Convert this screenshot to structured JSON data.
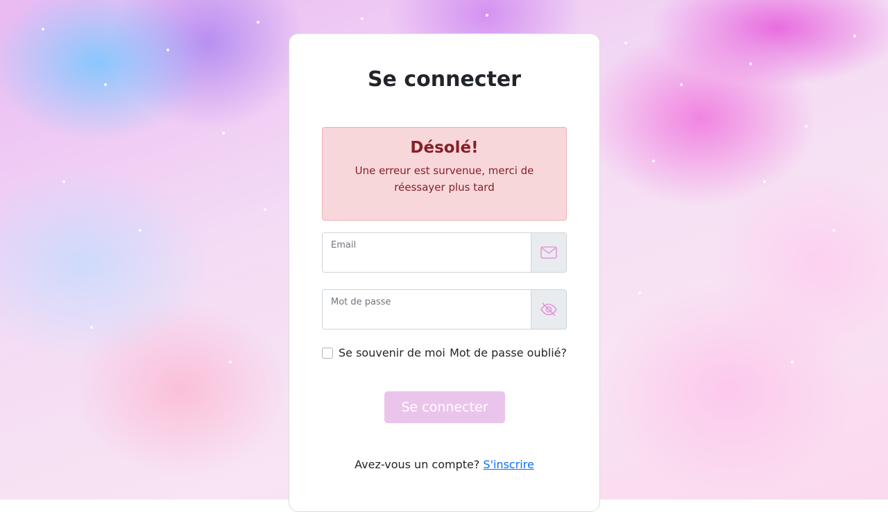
{
  "page": {
    "title": "Se connecter"
  },
  "alert": {
    "title": "Désolé!",
    "message": "Une erreur est survenue, merci de réessayer plus tard"
  },
  "email": {
    "label": "Email",
    "value": "",
    "icon": "envelope-icon"
  },
  "password": {
    "label": "Mot de passe",
    "value": "",
    "icon": "eye-slash-icon"
  },
  "options": {
    "remember_label": "Se souvenir de moi",
    "remember_checked": false,
    "forgot_label": "Mot de passe oublié?"
  },
  "submit": {
    "label": "Se connecter"
  },
  "signup": {
    "prompt": "Avez-vous un compte?",
    "link_label": "S'inscrire"
  },
  "colors": {
    "icon": "#e597dd",
    "submit_bg": "#ebc4ec",
    "alert_bg": "#f8d7da",
    "alert_text": "#842029",
    "link": "#0d6efd"
  }
}
